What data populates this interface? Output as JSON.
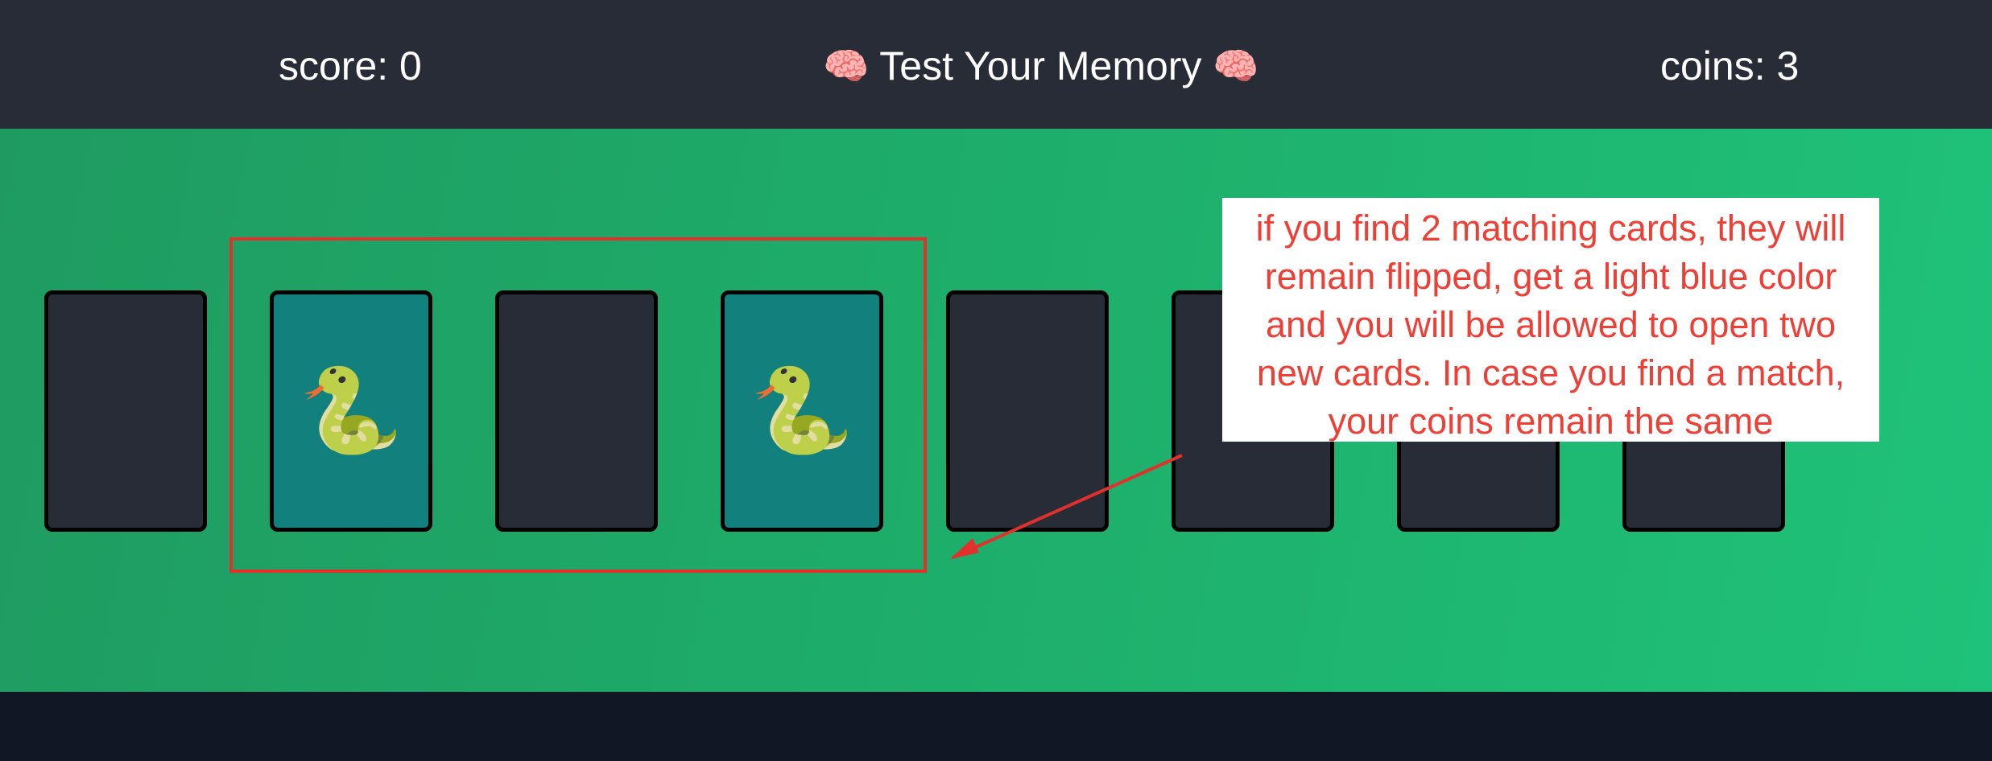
{
  "header": {
    "score_text": "score: 0",
    "title_prefix_icon": "🧠",
    "title": "Test Your Memory",
    "title_suffix_icon": "🧠",
    "coins_text": "coins: 3"
  },
  "cards": [
    {
      "state": "face-down",
      "symbol": ""
    },
    {
      "state": "matched",
      "symbol": "🐍",
      "icon": "snake-icon"
    },
    {
      "state": "face-down",
      "symbol": ""
    },
    {
      "state": "matched",
      "symbol": "🐍",
      "icon": "snake-icon"
    },
    {
      "state": "face-down",
      "symbol": ""
    },
    {
      "state": "face-down",
      "symbol": ""
    },
    {
      "state": "face-down",
      "symbol": ""
    },
    {
      "state": "face-down",
      "symbol": ""
    }
  ],
  "annotation": {
    "note_lines": [
      "if you find 2 matching cards, they will",
      "remain flipped, get a light blue color",
      "and you will be allowed to open two",
      "new cards. In case you find a match,",
      "your coins remain the same"
    ],
    "color": "#e2302b"
  },
  "colors": {
    "header_bg": "#282c36",
    "board_bg": "#1eb06c",
    "card_back": "#282c36",
    "card_matched": "#12807c",
    "footer_bg": "#111725"
  }
}
